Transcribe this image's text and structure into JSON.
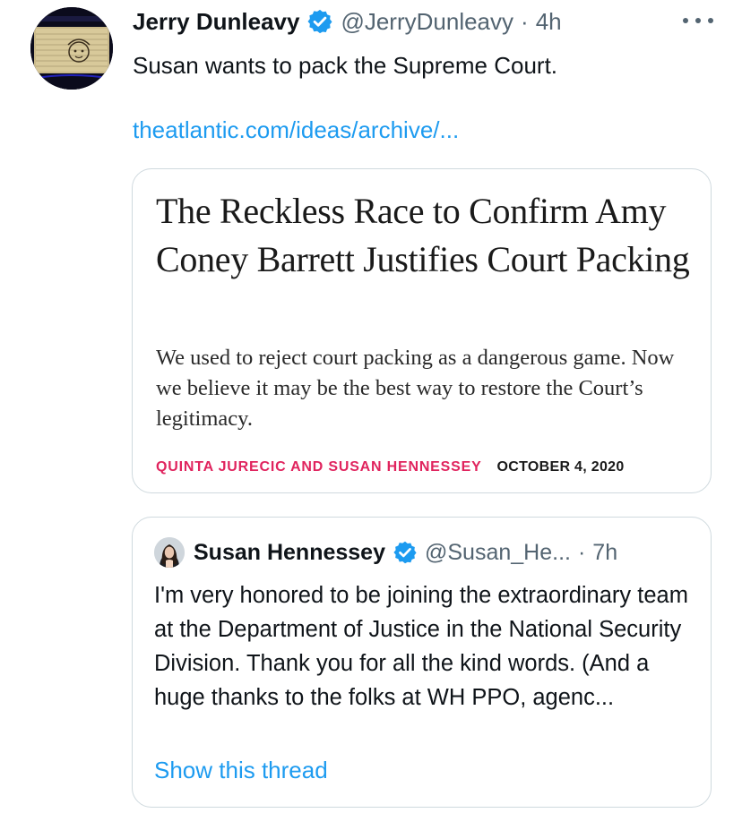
{
  "tweet": {
    "avatar_caption": "Amateur Sketch",
    "display_name": "Jerry Dunleavy",
    "handle": "@JerryDunleavy",
    "separator": "·",
    "time": "4h",
    "text": "Susan wants to pack the Supreme Court.",
    "link_text": "theatlantic.com/ideas/archive/...",
    "more_icon": "more-horizontal-icon",
    "verified_icon": "verified-badge-icon"
  },
  "link_card": {
    "headline": "The Reckless Race to Confirm Amy Coney Barrett Justifies Court Packing",
    "deck": "We used to reject court packing as a dangerous game. Now we believe it may be the best way to restore the Court’s legitimacy.",
    "authors": "QUINTA JURECIC AND SUSAN HENNESSEY",
    "date": "OCTOBER 4, 2020"
  },
  "quoted_tweet": {
    "display_name": "Susan Hennessey",
    "handle": "@Susan_He...",
    "separator": "·",
    "time": "7h",
    "text": "I'm very honored to be joining the extraordinary team at the Department of Justice in the National Security Division. Thank you for all the kind words. (And a huge thanks to the folks at WH PPO, agenc...",
    "show_thread": "Show this thread"
  },
  "colors": {
    "link_blue": "#1d9bf0",
    "verified_blue": "#1d9bf0",
    "byline_red": "#e0245e",
    "secondary_gray": "#536471",
    "border_gray": "#cfd9de"
  }
}
